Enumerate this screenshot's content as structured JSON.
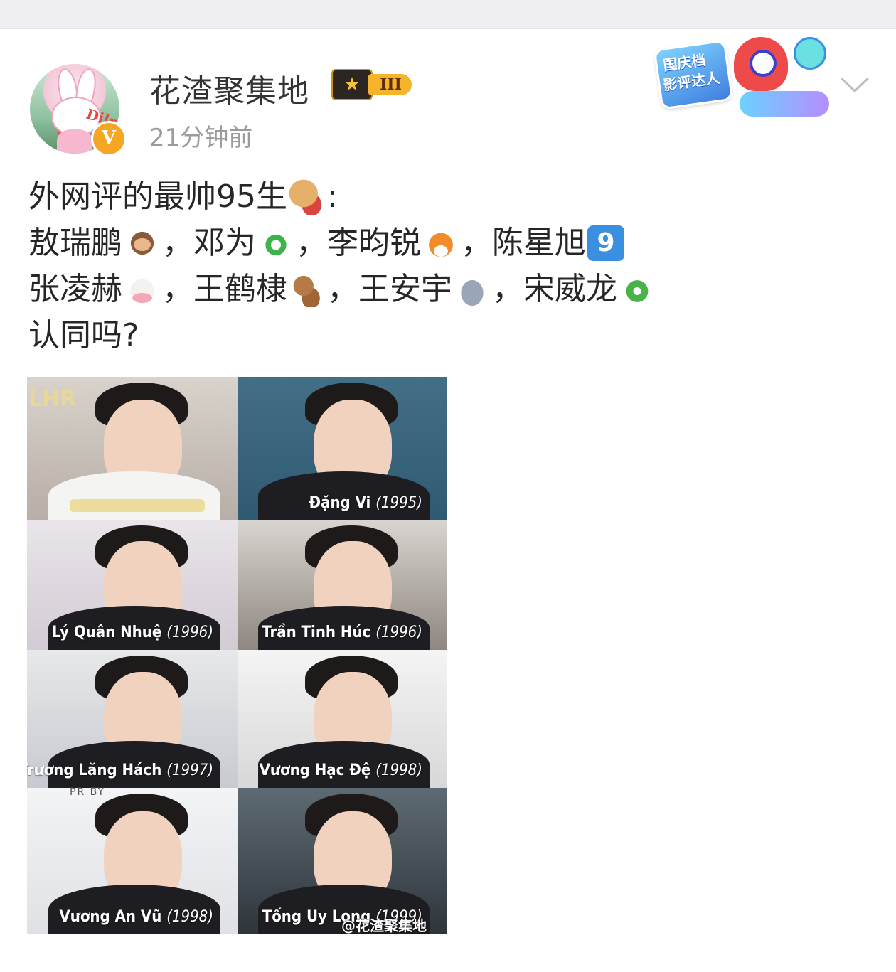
{
  "post": {
    "username": "花渣聚集地",
    "rank_level": "III",
    "time_ago": "21分钟前",
    "avatar_text": "Dilraba",
    "verified_mark": "V",
    "festival_badge": {
      "line1": "国庆档",
      "line2": "影评达人"
    },
    "text_lines": [
      "外网评的最帅95生",
      "敖瑞鹏",
      "，邓为",
      "，李昀锐",
      "，陈星旭",
      "张凌赫",
      "，王鹤棣",
      "，王安宇",
      "，宋威龙",
      "认同吗?"
    ],
    "colon": ":",
    "nine": "9",
    "photos": [
      {
        "name": "",
        "year": "",
        "logo": "LHR"
      },
      {
        "name": "Đặng Vi",
        "year": "(1995)"
      },
      {
        "name": "Lý Quân Nhuệ",
        "year": "(1996)"
      },
      {
        "name": "Trần Tinh Húc",
        "year": "(1996)"
      },
      {
        "name": "Trương Lăng Hách",
        "year": "(1997)"
      },
      {
        "name": "Vương Hạc Đệ",
        "year": "(1998)"
      },
      {
        "name": "Vương An Vũ",
        "year": "(1998)",
        "overlay": "PR            BY"
      },
      {
        "name": "Tống Uy Long",
        "year": "(1999)"
      }
    ],
    "watermark": "@花渣聚集地"
  },
  "icons": {
    "chevron": "chevron-down-icon",
    "crown": "crown-icon",
    "verified": "verified-badge-icon"
  },
  "colors": {
    "text": "#262626",
    "meta": "#9b9b9b",
    "badge_gold": "#f6b42b"
  }
}
